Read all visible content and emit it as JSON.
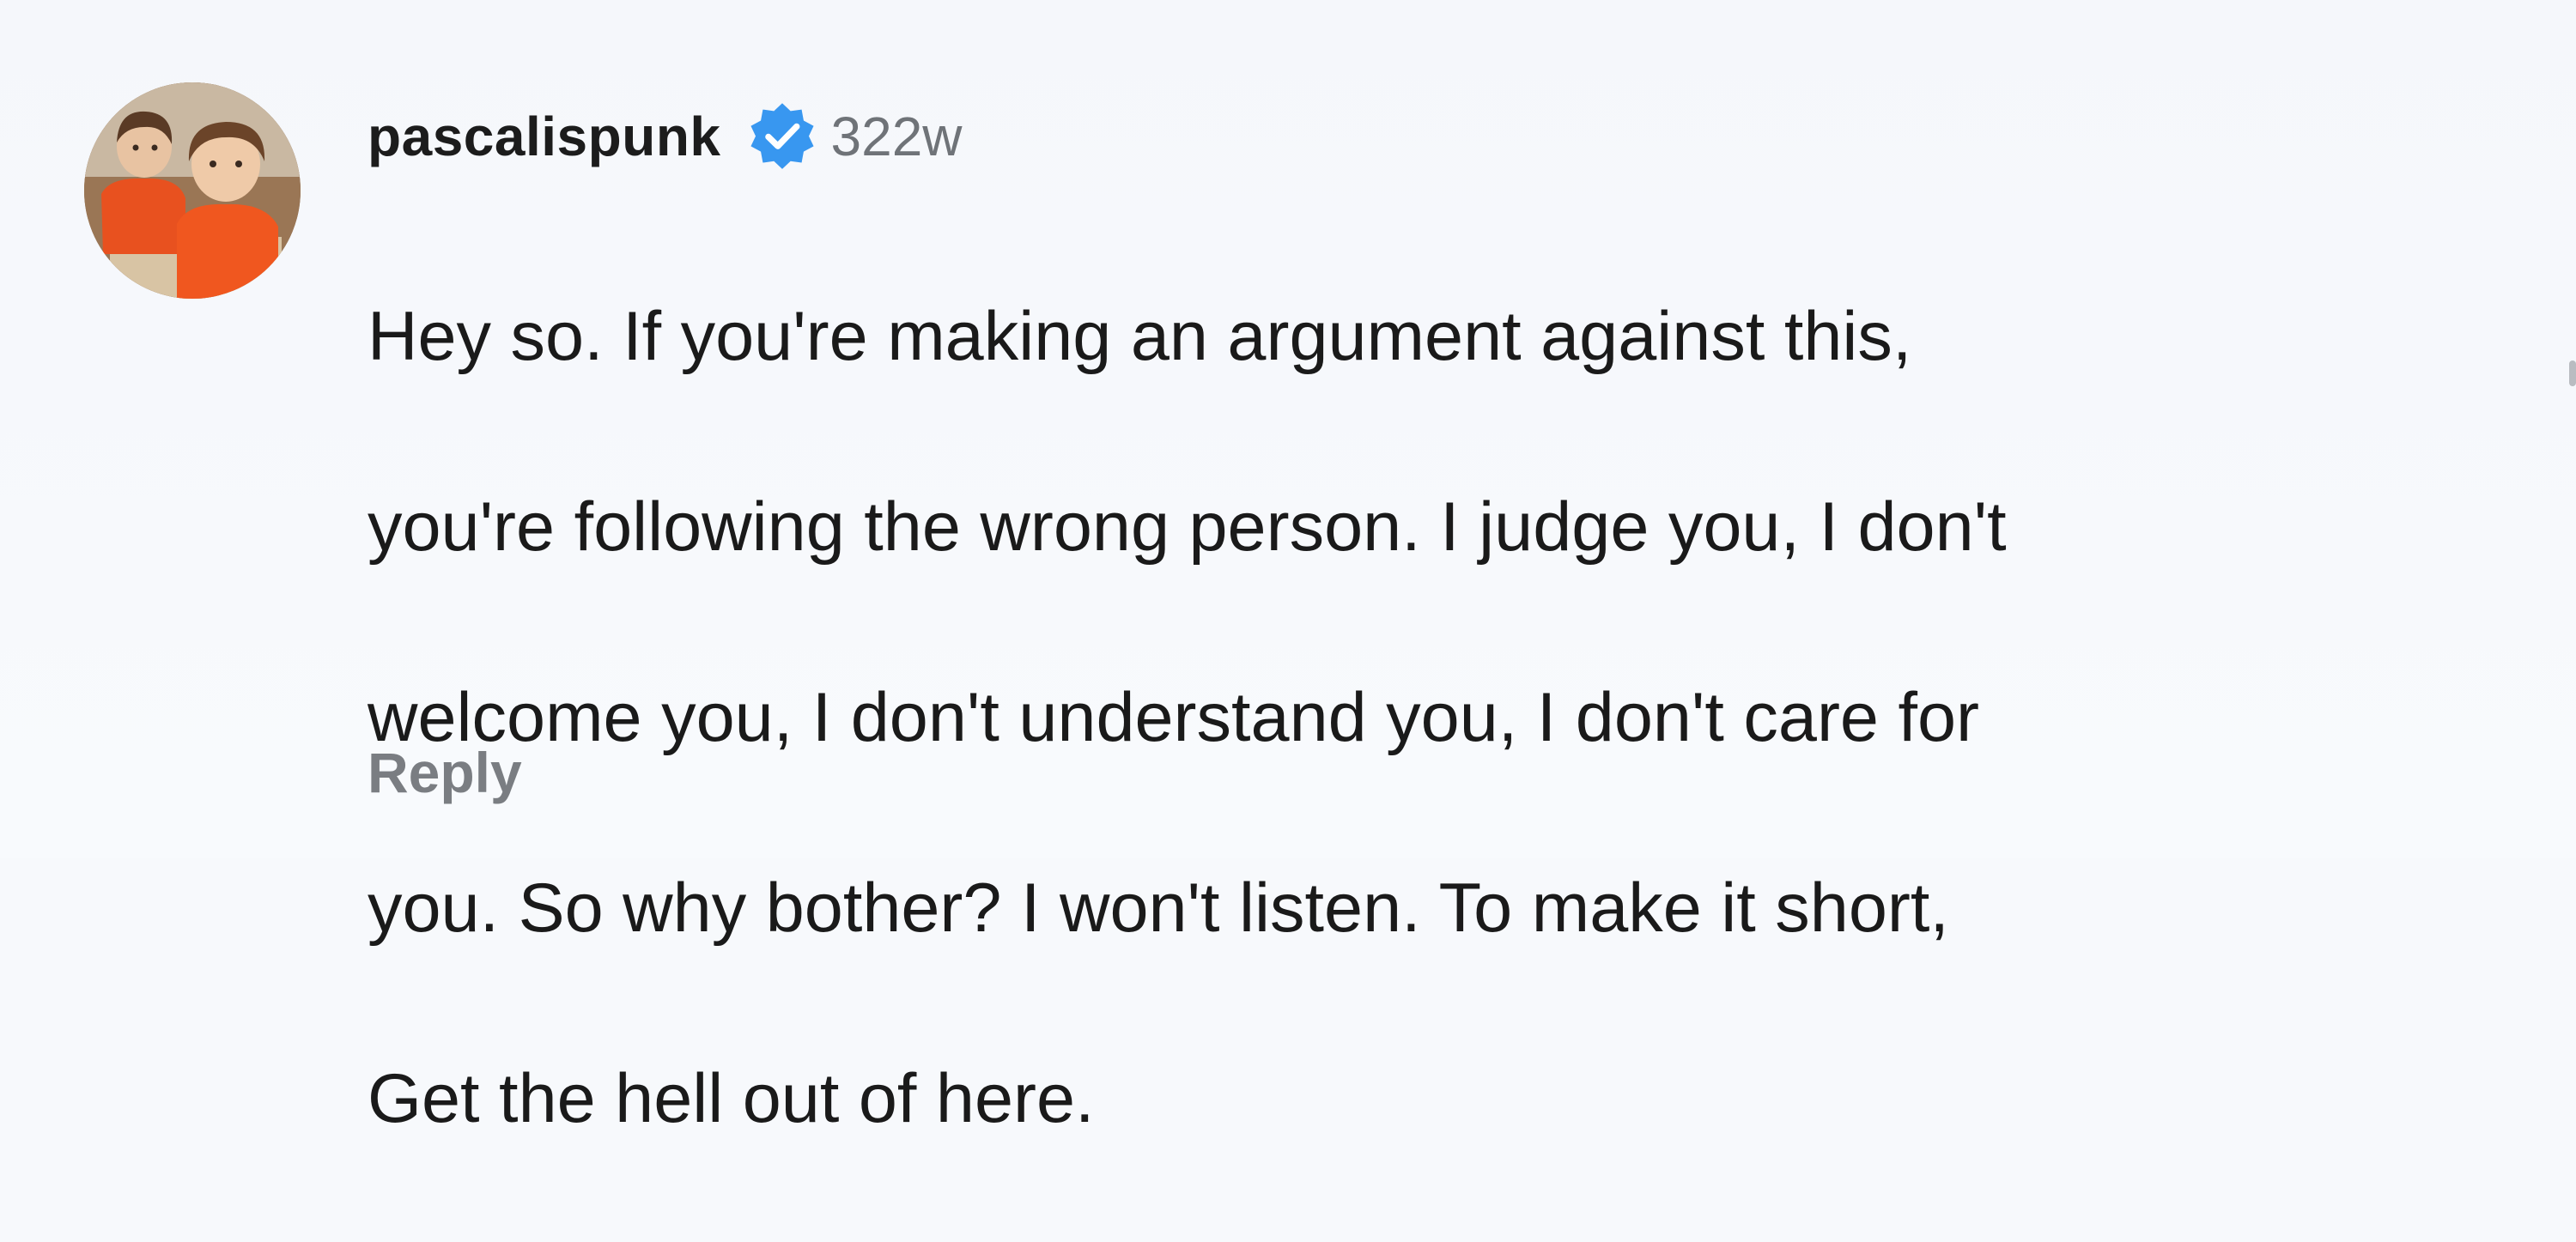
{
  "comment": {
    "username": "pascalispunk",
    "verified_icon": "verified-badge-icon",
    "timestamp": "322w",
    "lines": [
      "Hey so. If you're making an argument against this,",
      "you're following the wrong person. I judge you, I don't",
      "welcome you, I don't understand you, I don't care for",
      "you. So why bother?  I won't listen. To make it short,",
      "Get the hell out of here."
    ],
    "reply_label": "Reply"
  },
  "colors": {
    "background": "#f7f9fc",
    "verified_blue": "#3897f0",
    "reply_gray": "#7a7d82",
    "timestamp_gray": "#6f7378"
  }
}
